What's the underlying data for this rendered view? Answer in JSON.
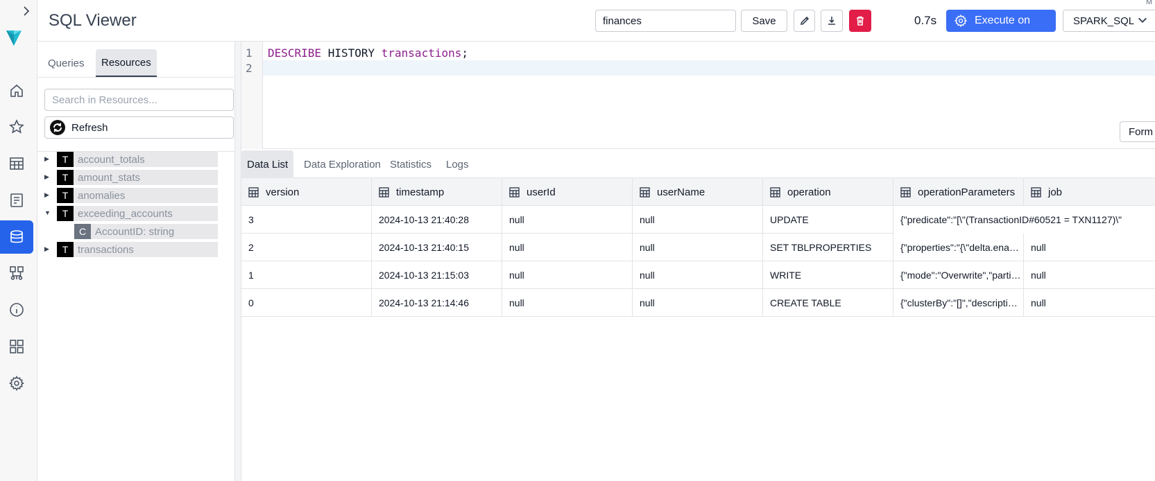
{
  "app": {
    "title": "SQL Viewer"
  },
  "header": {
    "query_name": "finances",
    "save_label": "Save",
    "exec_time": "0.7s",
    "execute_label": "Execute on",
    "engine": "SPARK_SQL",
    "partial_button": "1",
    "partial_top": "M"
  },
  "panel": {
    "tabs": [
      "Queries",
      "Resources"
    ],
    "search_placeholder": "Search in Resources...",
    "refresh_label": "Refresh",
    "tree": [
      {
        "badge": "T",
        "label": "account_totals",
        "caret": "▶"
      },
      {
        "badge": "T",
        "label": "amount_stats",
        "caret": "▶"
      },
      {
        "badge": "T",
        "label": "anomalies",
        "caret": "▶"
      },
      {
        "badge": "T",
        "label": "exceeding_accounts",
        "caret": "▼"
      },
      {
        "badge": "C",
        "label": "AccountID: string",
        "caret": ""
      },
      {
        "badge": "T",
        "label": "transactions",
        "caret": "▶"
      }
    ]
  },
  "editor": {
    "line_numbers": [
      "1",
      "2"
    ],
    "code": {
      "kw1": "DESCRIBE",
      "kw2": " HISTORY ",
      "ident": "transactions",
      "end": ";"
    },
    "format_label": "Form"
  },
  "results": {
    "tabs": [
      "Data List",
      "Data Exploration",
      "Statistics",
      "Logs"
    ],
    "columns": [
      "version",
      "timestamp",
      "userId",
      "userName",
      "operation",
      "operationParameters",
      "job"
    ],
    "rows": [
      [
        "3",
        "2024-10-13 21:40:28",
        "null",
        "null",
        "UPDATE",
        "{\"predicate\":\"[\\\"(TransactionID#60521 = TXN1127)\\\"",
        ""
      ],
      [
        "2",
        "2024-10-13 21:40:15",
        "null",
        "null",
        "SET TBLPROPERTIES",
        "{\"properties\":\"{\\\"delta.enableDeletionVectors\\\"",
        "null"
      ],
      [
        "1",
        "2024-10-13 21:15:03",
        "null",
        "null",
        "WRITE",
        "{\"mode\":\"Overwrite\",\"partitionBy\":\"[]\"}",
        "null"
      ],
      [
        "0",
        "2024-10-13 21:14:46",
        "null",
        "null",
        "CREATE TABLE",
        "{\"clusterBy\":\"[]\",\"description\":null}",
        "null"
      ]
    ]
  },
  "rail": {
    "icons": [
      "home-icon",
      "star-icon",
      "table-icon",
      "document-icon",
      "database-icon",
      "pipeline-icon",
      "info-icon",
      "grid-icon",
      "gear-icon"
    ]
  }
}
